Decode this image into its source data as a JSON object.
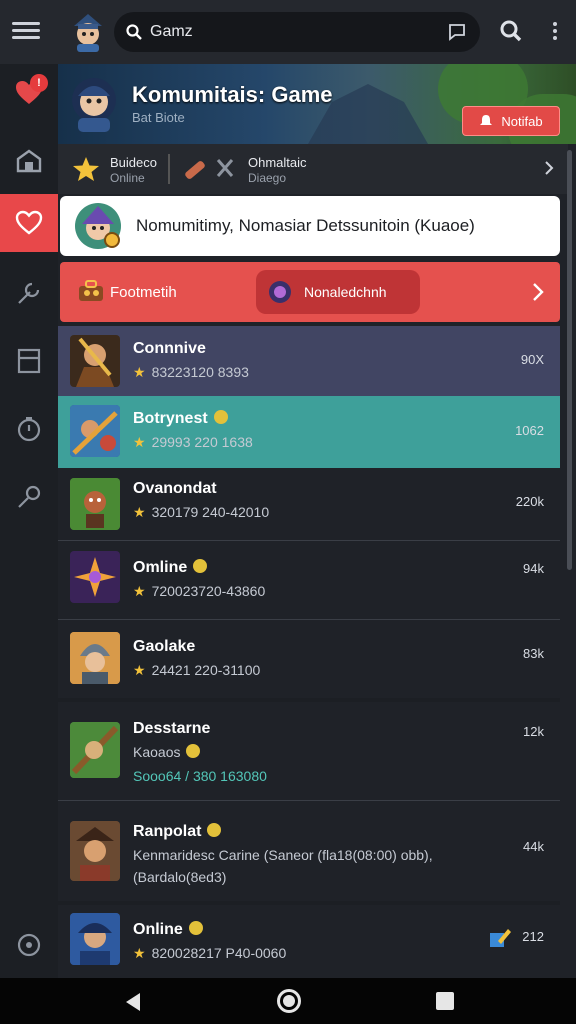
{
  "app": {
    "search_query": "Gamz",
    "colors": {
      "accent": "#e8484a",
      "highlight_row": "#3ea09a",
      "selected_row": "#414563",
      "star": "#f2c23b"
    }
  },
  "header": {
    "title": "Komumitais: Game",
    "subtitle": "Bat Biote",
    "button_label": "Notifab",
    "button_icon": "bell-icon"
  },
  "status": {
    "left_title": "Buideco",
    "left_sub": "Online",
    "right_title": "Ohmaltaic",
    "right_sub": "Diaego"
  },
  "welcome_card": {
    "text": "Nomumitimy, Nomasiar Detssunitoin (Kuaoe)"
  },
  "banner": {
    "left_label": "Footmetih",
    "pill_label": "Nonaledchnh"
  },
  "list": [
    {
      "name": "Connnive",
      "meta": "83223120 8393",
      "count": "90X",
      "thumb": "warrior-thumb"
    },
    {
      "name": "Botrynest",
      "meta": "29993 220 1638",
      "count": "1062",
      "thumb": "battle-thumb"
    },
    {
      "name": "Ovanondat",
      "meta": "320179 240-42010",
      "count": "220k",
      "thumb": "goblin-thumb"
    },
    {
      "name": "Omline",
      "meta": "720023720-43860",
      "count": "94k",
      "thumb": "mage-thumb"
    },
    {
      "name": "Gaolake",
      "meta": "24421 220-31100",
      "count": "83k",
      "thumb": "knight-thumb"
    },
    {
      "name": "Desstarne",
      "sub": "Kaoaos",
      "meta": "Sooo64 / 380 163080",
      "count": "12k",
      "thumb": "ranger-thumb"
    },
    {
      "name": "Ranpolat",
      "sub": "Kenmaridesc Carine (Saneor (fla18(08:00) obb),",
      "sub2": "(Bardalo(8ed3)",
      "count": "44k",
      "thumb": "pirate-thumb"
    },
    {
      "name": "Online",
      "meta": "820028217 P40-0060",
      "count": "212",
      "thumb": "hero-thumb"
    }
  ]
}
